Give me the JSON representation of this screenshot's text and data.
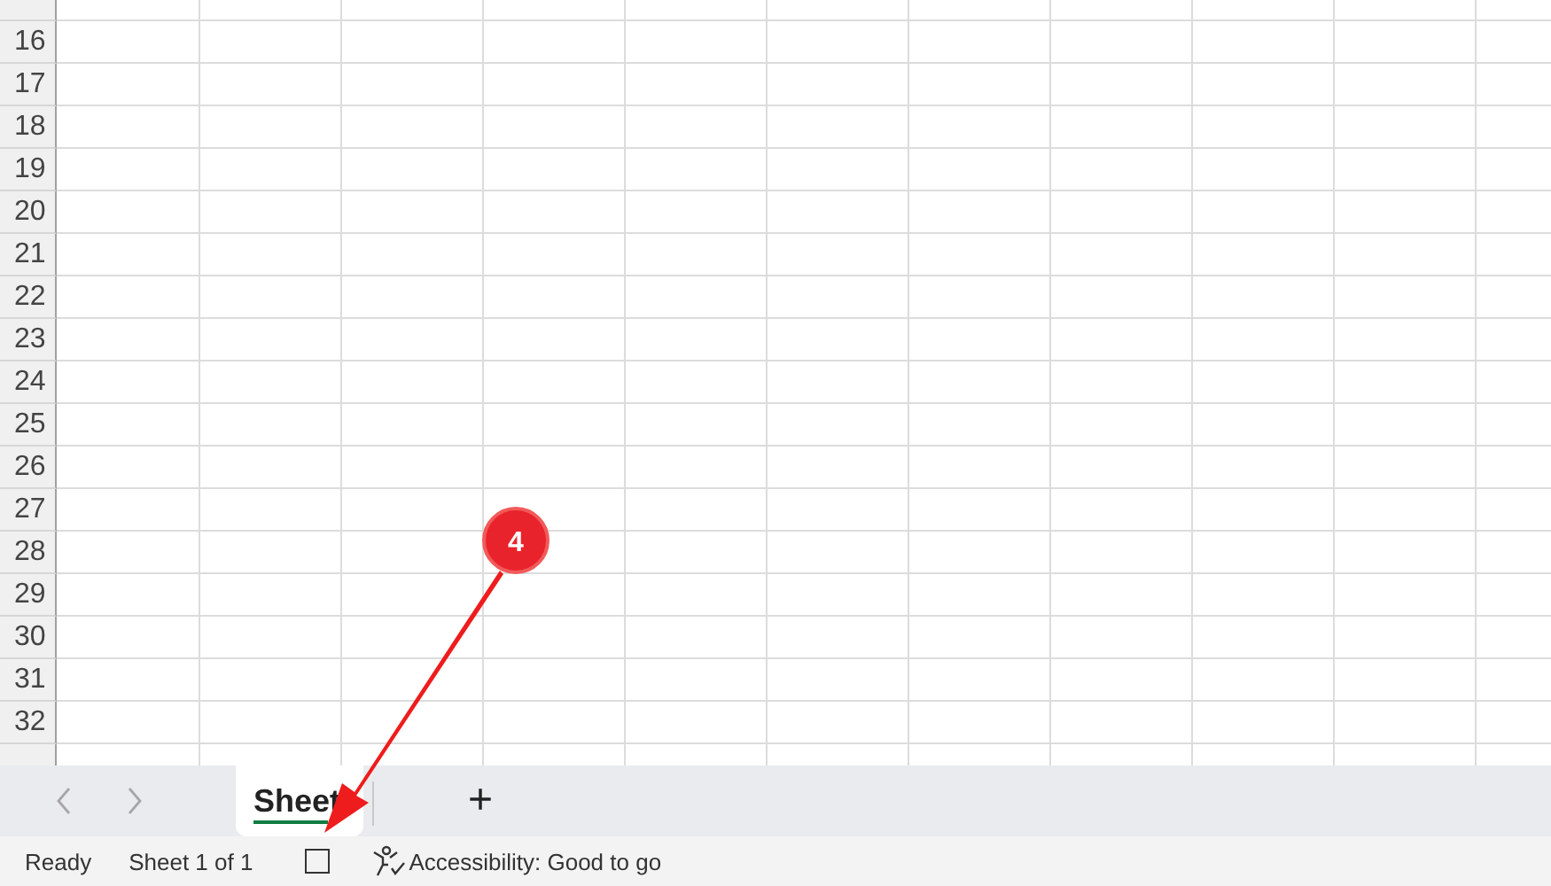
{
  "rows": [
    "16",
    "17",
    "18",
    "19",
    "20",
    "21",
    "22",
    "23",
    "24",
    "25",
    "26",
    "27",
    "28",
    "29",
    "30",
    "31",
    "32"
  ],
  "sheet_nav": {
    "prev": {
      "disabled": true
    },
    "next": {
      "disabled": true
    }
  },
  "tabs": [
    {
      "label": "Sheet",
      "selected": true
    }
  ],
  "add_sheet": "+",
  "status_bar": {
    "ready": "Ready",
    "sheet_info": "Sheet 1 of 1",
    "accessibility": "Accessibility: Good to go"
  },
  "annotation": {
    "label": "4"
  }
}
